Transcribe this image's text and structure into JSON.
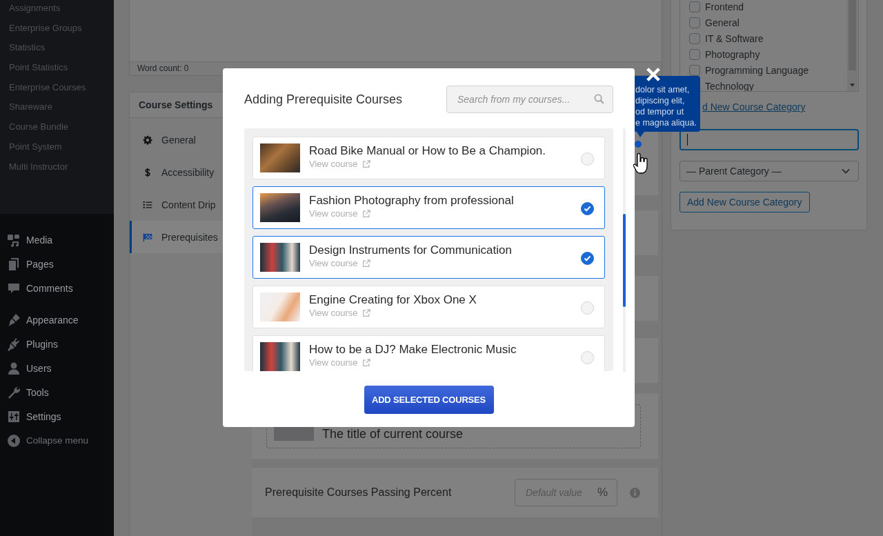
{
  "sidebar": {
    "submenu": [
      "Assignments",
      "Enterprise Groups",
      "Statistics",
      "Point Statistics",
      "Enterprise Courses",
      "Shareware",
      "Course Bundle",
      "Point System",
      "Multi Instructor"
    ],
    "menu_groups": [
      [
        "Media",
        "Pages",
        "Comments"
      ],
      [
        "Appearance",
        "Plugins",
        "Users",
        "Tools",
        "Settings"
      ]
    ],
    "collapse": "Collapse menu"
  },
  "editor": {
    "word_count": "Word count: 0"
  },
  "course_settings": {
    "title": "Course Settings",
    "tabs": [
      {
        "label": "General",
        "selected": false
      },
      {
        "label": "Accessibility",
        "selected": false
      },
      {
        "label": "Content Drip",
        "selected": false
      },
      {
        "label": "Prerequisites",
        "selected": true
      }
    ],
    "current_course": "The title of current course",
    "passing_percent": {
      "label": "Prerequisite Courses Passing Percent",
      "placeholder": "Default value",
      "unit": "%"
    }
  },
  "categories": {
    "items": [
      {
        "label": "Frontend",
        "checked": false
      },
      {
        "label": "General",
        "checked": false
      },
      {
        "label": "IT & Software",
        "checked": false
      },
      {
        "label": "Photography",
        "checked": false
      },
      {
        "label": "Programming Language",
        "checked": false
      },
      {
        "label": "Technology"
      }
    ],
    "add_link": "d New Course Category",
    "name_field": {
      "focused": true
    },
    "parent_select": "— Parent Category —",
    "add_button": "Add New Course Category"
  },
  "tooltip": {
    "lines": [
      "dolor sit amet,",
      "dipiscing elit,",
      "od tempor ut",
      "e magna aliqua."
    ]
  },
  "modal": {
    "title": "Adding Prerequisite Courses",
    "search": {
      "placeholder": "Search from my courses..."
    },
    "courses": [
      {
        "title": "Road Bike Manual or How to Be a Champion.",
        "link": "View course",
        "selected": false
      },
      {
        "title": "Fashion Photography from professional",
        "link": "View course",
        "selected": true
      },
      {
        "title": "Design Instruments for Communication",
        "link": "View course",
        "selected": true
      },
      {
        "title": "Engine Creating for Xbox One X",
        "link": "View course",
        "selected": false
      },
      {
        "title": "How to be a DJ? Make Electronic Music",
        "link": "View course",
        "selected": false
      }
    ],
    "button": "ADD SELECTED COURSES"
  }
}
